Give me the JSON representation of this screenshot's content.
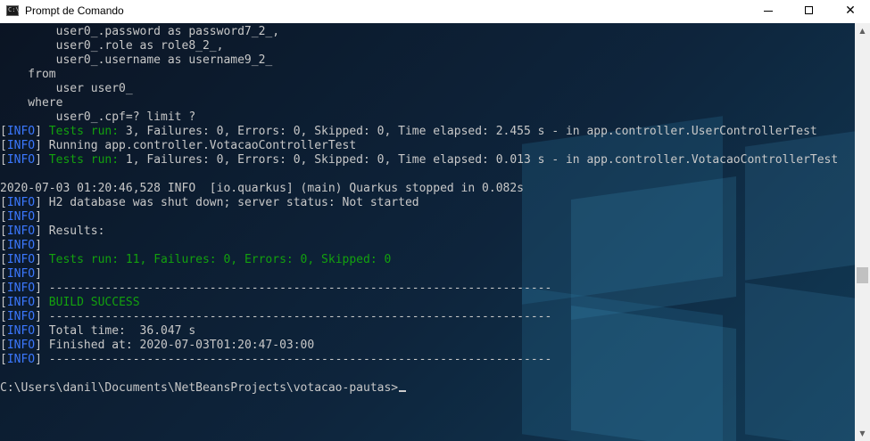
{
  "window": {
    "title": "Prompt de Comando",
    "icon_label": "C:\\",
    "controls": {
      "minimize": "minimize-icon",
      "maximize": "maximize-icon",
      "close": "close-icon",
      "close_glyph": "✕"
    }
  },
  "colors": {
    "info_tag": "#3b78ff",
    "success_text": "#13a10e",
    "text": "#c8c8c8"
  },
  "console": {
    "lines": [
      {
        "segments": [
          {
            "text": "        user0_.password as password7_2_,"
          }
        ]
      },
      {
        "segments": [
          {
            "text": "        user0_.role as role8_2_,"
          }
        ]
      },
      {
        "segments": [
          {
            "text": "        user0_.username as username9_2_"
          }
        ]
      },
      {
        "segments": [
          {
            "text": "    from"
          }
        ]
      },
      {
        "segments": [
          {
            "text": "        user user0_"
          }
        ]
      },
      {
        "segments": [
          {
            "text": "    where"
          }
        ]
      },
      {
        "segments": [
          {
            "text": "        user0_.cpf=? limit ?"
          }
        ]
      },
      {
        "segments": [
          {
            "text": "["
          },
          {
            "text": "INFO",
            "style": "info"
          },
          {
            "text": "] "
          },
          {
            "text": "Tests run: ",
            "style": "green"
          },
          {
            "text": "3, Failures: 0, Errors: 0, Skipped: 0, Time elapsed: 2.455 s - in app.controller.UserControllerTest"
          }
        ]
      },
      {
        "segments": [
          {
            "text": "["
          },
          {
            "text": "INFO",
            "style": "info"
          },
          {
            "text": "] Running app.controller.VotacaoControllerTest"
          }
        ]
      },
      {
        "segments": [
          {
            "text": "["
          },
          {
            "text": "INFO",
            "style": "info"
          },
          {
            "text": "] "
          },
          {
            "text": "Tests run: ",
            "style": "green"
          },
          {
            "text": "1, Failures: 0, Errors: 0, Skipped: 0, Time elapsed: 0.013 s - in app.controller.VotacaoControllerTest"
          }
        ]
      },
      {
        "segments": [
          {
            "text": ""
          }
        ]
      },
      {
        "segments": [
          {
            "text": "2020-07-03 01:20:46,528 INFO  [io.quarkus] (main) Quarkus stopped in 0.082s"
          }
        ]
      },
      {
        "segments": [
          {
            "text": "["
          },
          {
            "text": "INFO",
            "style": "info"
          },
          {
            "text": "] H2 database was shut down; server status: Not started"
          }
        ]
      },
      {
        "segments": [
          {
            "text": "["
          },
          {
            "text": "INFO",
            "style": "info"
          },
          {
            "text": "]"
          }
        ]
      },
      {
        "segments": [
          {
            "text": "["
          },
          {
            "text": "INFO",
            "style": "info"
          },
          {
            "text": "] Results:"
          }
        ]
      },
      {
        "segments": [
          {
            "text": "["
          },
          {
            "text": "INFO",
            "style": "info"
          },
          {
            "text": "]"
          }
        ]
      },
      {
        "segments": [
          {
            "text": "["
          },
          {
            "text": "INFO",
            "style": "info"
          },
          {
            "text": "] "
          },
          {
            "text": "Tests run: 11, Failures: 0, Errors: 0, Skipped: 0",
            "style": "green"
          }
        ]
      },
      {
        "segments": [
          {
            "text": "["
          },
          {
            "text": "INFO",
            "style": "info"
          },
          {
            "text": "]"
          }
        ]
      },
      {
        "segments": [
          {
            "text": "["
          },
          {
            "text": "INFO",
            "style": "info"
          },
          {
            "text": "] ------------------------------------------------------------------------"
          }
        ]
      },
      {
        "segments": [
          {
            "text": "["
          },
          {
            "text": "INFO",
            "style": "info"
          },
          {
            "text": "] "
          },
          {
            "text": "BUILD SUCCESS",
            "style": "green"
          }
        ]
      },
      {
        "segments": [
          {
            "text": "["
          },
          {
            "text": "INFO",
            "style": "info"
          },
          {
            "text": "] ------------------------------------------------------------------------"
          }
        ]
      },
      {
        "segments": [
          {
            "text": "["
          },
          {
            "text": "INFO",
            "style": "info"
          },
          {
            "text": "] Total time:  36.047 s"
          }
        ]
      },
      {
        "segments": [
          {
            "text": "["
          },
          {
            "text": "INFO",
            "style": "info"
          },
          {
            "text": "] Finished at: 2020-07-03T01:20:47-03:00"
          }
        ]
      },
      {
        "segments": [
          {
            "text": "["
          },
          {
            "text": "INFO",
            "style": "info"
          },
          {
            "text": "] ------------------------------------------------------------------------"
          }
        ]
      },
      {
        "segments": [
          {
            "text": ""
          }
        ]
      },
      {
        "segments": [
          {
            "text": "C:\\Users\\danil\\Documents\\NetBeansProjects\\votacao-pautas>"
          }
        ],
        "prompt": true
      }
    ]
  },
  "scrollbar": {
    "up_glyph": "▲",
    "down_glyph": "▼"
  }
}
